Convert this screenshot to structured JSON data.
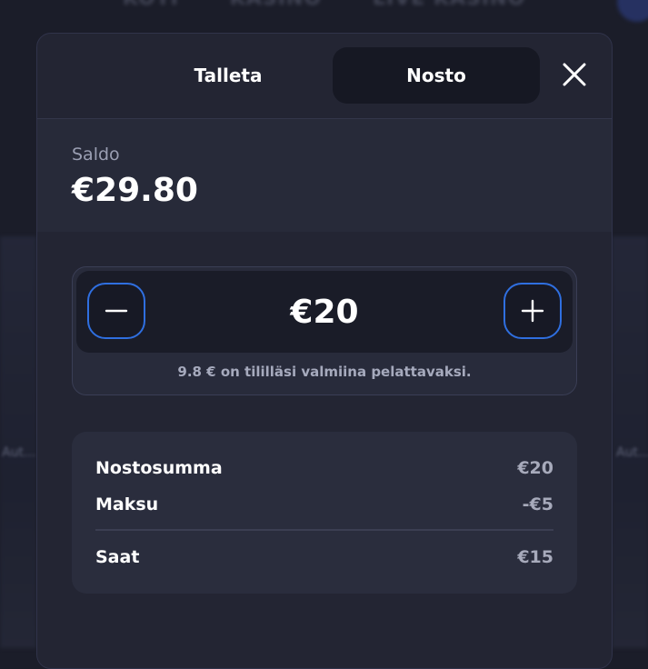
{
  "background": {
    "nav": [
      "KOTI",
      "KASINO",
      "LIVE KASINO"
    ],
    "side_left": "Aut...",
    "side_right": "Aut..."
  },
  "tabs": [
    {
      "label": "Talleta",
      "active": false
    },
    {
      "label": "Nosto",
      "active": true
    }
  ],
  "balance": {
    "label": "Saldo",
    "value": "€29.80"
  },
  "amount": {
    "value": "€20",
    "hint": "9.8 € on tililläsi valmiina pelattavaksi."
  },
  "summary": {
    "rows": [
      {
        "label": "Nostosumma",
        "value": "€20"
      },
      {
        "label": "Maksu",
        "value": "-€5"
      },
      {
        "label": "Saat",
        "value": "€15"
      }
    ]
  },
  "colors": {
    "accent": "#2f6fe0",
    "modal_bg": "#232533",
    "page_bg": "#1b1d29"
  },
  "icons": {
    "close": "close-icon",
    "minus": "minus-icon",
    "plus": "plus-icon"
  }
}
